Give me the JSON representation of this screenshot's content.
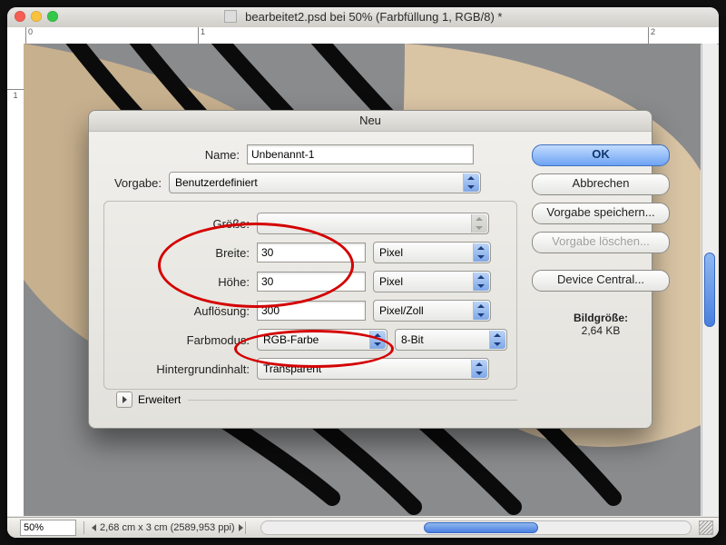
{
  "window": {
    "title": "bearbeitet2.psd bei 50% (Farbfüllung 1, RGB/8) *",
    "ruler_h": [
      "0",
      "1",
      "2"
    ],
    "ruler_v": [
      "1"
    ],
    "zoom": "50%",
    "status_info": "2,68 cm x 3 cm (2589,953 ppi)"
  },
  "dialog": {
    "title": "Neu",
    "labels": {
      "name": "Name:",
      "preset": "Vorgabe:",
      "size": "Größe:",
      "width": "Breite:",
      "height": "Höhe:",
      "resolution": "Auflösung:",
      "color_mode": "Farbmodus:",
      "bg_content": "Hintergrundinhalt:",
      "advanced": "Erweitert"
    },
    "values": {
      "name": "Unbenannt-1",
      "preset": "Benutzerdefiniert",
      "size": "",
      "width": "30",
      "width_unit": "Pixel",
      "height": "30",
      "height_unit": "Pixel",
      "resolution": "300",
      "resolution_unit": "Pixel/Zoll",
      "color_mode": "RGB-Farbe",
      "bit_depth": "8-Bit",
      "bg_content": "Transparent"
    },
    "buttons": {
      "ok": "OK",
      "cancel": "Abbrechen",
      "save_preset": "Vorgabe speichern...",
      "delete_preset": "Vorgabe löschen...",
      "device_central": "Device Central..."
    },
    "info": {
      "image_size_label": "Bildgröße:",
      "image_size_value": "2,64 KB"
    }
  }
}
